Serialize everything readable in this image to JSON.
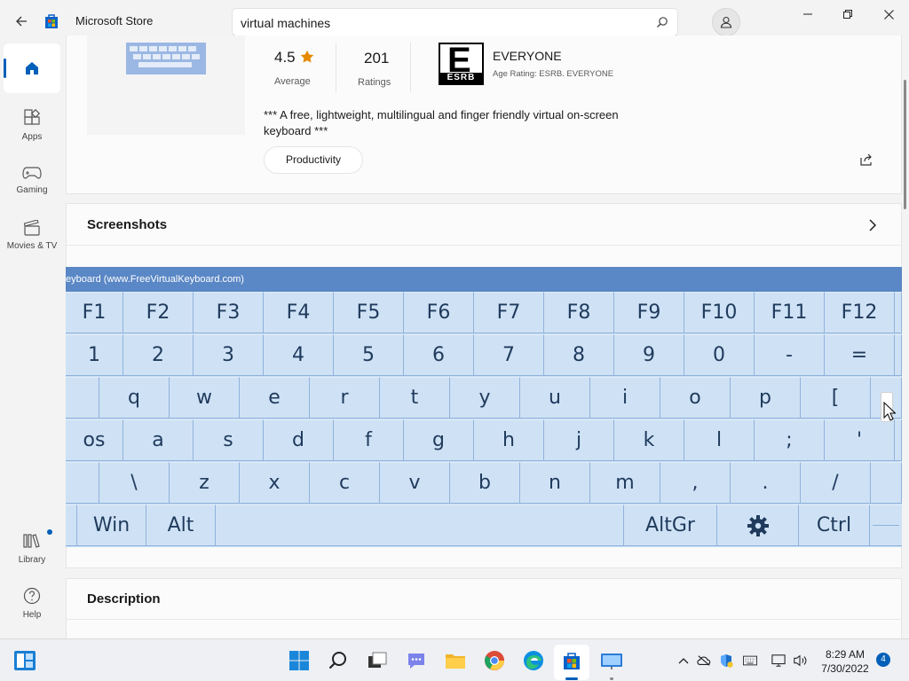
{
  "app": {
    "title": "Microsoft Store"
  },
  "search": {
    "value": "virtual machines"
  },
  "nav": {
    "apps": "Apps",
    "gaming": "Gaming",
    "movies": "Movies & TV",
    "library": "Library",
    "help": "Help"
  },
  "product": {
    "rating_value": "4.5",
    "rating_label": "Average",
    "ratings_count": "201",
    "ratings_label": "Ratings",
    "esrb_letter": "E",
    "esrb_band": "ESRB",
    "age_rating": "EVERYONE",
    "age_rating_sub": "Age Rating: ESRB. EVERYONE",
    "description_line1": "*** A free, lightweight, multilingual and finger friendly virtual on-screen",
    "description_line2": "keyboard ***",
    "tag": "Productivity"
  },
  "sections": {
    "screenshots": "Screenshots",
    "description": "Description"
  },
  "keyboard": {
    "title": "eyboard (www.FreeVirtualKeyboard.com)",
    "row_f": [
      "F1",
      "F2",
      "F3",
      "F4",
      "F5",
      "F6",
      "F7",
      "F8",
      "F9",
      "F10",
      "F11",
      "F12"
    ],
    "row_num": [
      "1",
      "2",
      "3",
      "4",
      "5",
      "6",
      "7",
      "8",
      "9",
      "0",
      "-",
      "="
    ],
    "row_q": [
      "",
      "q",
      "w",
      "e",
      "r",
      "t",
      "y",
      "u",
      "i",
      "o",
      "p",
      "[",
      ""
    ],
    "row_a": [
      "os",
      "a",
      "s",
      "d",
      "f",
      "g",
      "h",
      "j",
      "k",
      "l",
      ";",
      "'",
      ""
    ],
    "row_z": [
      "",
      "\\",
      "z",
      "x",
      "c",
      "v",
      "b",
      "n",
      "m",
      ",",
      ".",
      "/",
      ""
    ],
    "row_bottom": {
      "win": "Win",
      "alt": "Alt",
      "altgr": "AltGr",
      "ctrl": "Ctrl"
    }
  },
  "taskbar": {
    "time": "8:29 AM",
    "date": "7/30/2022",
    "notifications": "4"
  }
}
